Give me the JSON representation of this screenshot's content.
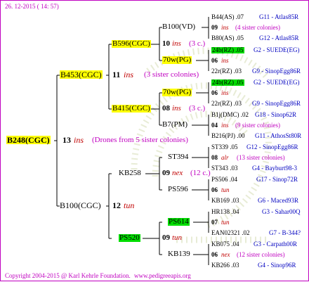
{
  "header": {
    "date": "26. 12-2015 ( 14: 57)"
  },
  "footer": {
    "copyright": "Copyright 2004-2015 @ Karl Kehrle Foundation.",
    "site": "www.pedigreeapis.org"
  },
  "root": {
    "name": "B248(CGC)",
    "num": "13",
    "tag": "ins",
    "note": "(Drones from 5 sister colonies)"
  },
  "gen1": {
    "top": {
      "name": "B453(CGC)",
      "num": "11",
      "tag": "ins",
      "note": "(3 sister colonies)"
    },
    "bot": {
      "name": "B100(CGC)",
      "num": "12",
      "tag": "tun"
    }
  },
  "gen2": {
    "a": {
      "name": "B596(CGC)"
    },
    "b": {
      "name": "B415(CGC)"
    },
    "c": {
      "name": "KB258"
    },
    "d": {
      "name": "PS520"
    }
  },
  "gen3": {
    "a1": {
      "name": "B100(VD)",
      "num": "10",
      "tag": "ins",
      "note": "(3 c.)"
    },
    "a2": {
      "name": "70w(PG)"
    },
    "b1": {
      "name": "70w(PG)"
    },
    "b2": {
      "name": "B7(PM)",
      "num": "08",
      "tag": "ins",
      "note": "(3 c.)"
    },
    "c1": {
      "name": "ST394"
    },
    "c2": {
      "name": "PS596",
      "num": "09",
      "tag": "nex",
      "note": "(12 c.)"
    },
    "d1": {
      "name": "PS614"
    },
    "d2": {
      "name": "KB139",
      "num": "09",
      "tag": "tun"
    }
  },
  "gen4": [
    {
      "name": "B44(AS) .07",
      "ref": "G11 - Atlas85R"
    },
    {
      "name": "09",
      "tag": "ins",
      "note": "(4 sister colonies)"
    },
    {
      "name": "B80(AS) .05",
      "ref": "G12 - Atlas85R"
    },
    {
      "name": "24b(RZ) .05",
      "ref": "G2 - SUEDE(EG)"
    },
    {
      "name": "06",
      "tag": "ins"
    },
    {
      "name": "22r(RZ) .03",
      "ref": "G9 - SinopEgg86R"
    },
    {
      "name": "24b(RZ) .05",
      "ref": "G2 - SUEDE(EG)"
    },
    {
      "name": "06",
      "tag": "ins"
    },
    {
      "name": "22r(RZ) .03",
      "ref": "G9 - SinopEgg86R"
    },
    {
      "name": "B1j(DMC) .02",
      "ref": "G18 - Sinop62R"
    },
    {
      "name": "04",
      "tag": "ins",
      "note": "(9 sister colonies)"
    },
    {
      "name": "B216(PJ) .00",
      "ref": "G11 - AthosSt80R"
    },
    {
      "name": "ST339 .05",
      "ref": "G12 - SinopEgg86R"
    },
    {
      "name": "08",
      "tag": "alr",
      "note": "(13 sister colonies)"
    },
    {
      "name": "ST343 .03",
      "ref": "G4 - Bayburt98-3"
    },
    {
      "name": "PS506 .04",
      "ref": "G17 - Sinop72R"
    },
    {
      "name": "06",
      "tag": "tun"
    },
    {
      "name": "KB169 .03",
      "ref": "G6 - Maced93R"
    },
    {
      "name": "HR138 .04",
      "ref": "G3 - Sahar00Q"
    },
    {
      "name": "07",
      "tag": "tun"
    },
    {
      "name": "EAN02321 .02",
      "ref": "G7 - B-344?"
    },
    {
      "name": "KB075 .04",
      "ref": "G3 - Carpath00R"
    },
    {
      "name": "06",
      "tag": "nex",
      "note": "(12 sister colonies)"
    },
    {
      "name": "KB266 .03",
      "ref": "G4 - Sinop96R"
    }
  ]
}
